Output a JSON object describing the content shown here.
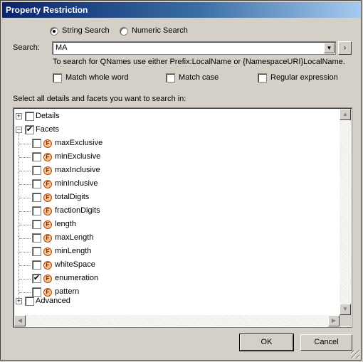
{
  "window": {
    "title": "Property Restriction"
  },
  "search_type": {
    "string_label": "String Search",
    "numeric_label": "Numeric Search",
    "selected": "string"
  },
  "search": {
    "label": "Search:",
    "value": "MA",
    "hint": "To search for QNames use either Prefix:LocalName or {NamespaceURI}LocalName."
  },
  "options": {
    "match_whole_word": {
      "label": "Match whole word",
      "checked": false
    },
    "match_case": {
      "label": "Match case",
      "checked": false
    },
    "regex": {
      "label": "Regular expression",
      "checked": false
    }
  },
  "tree_label": "Select all details and facets you want to search in:",
  "tree": {
    "details": {
      "label": "Details",
      "checked": false,
      "expanded": false
    },
    "facets": {
      "label": "Facets",
      "checked": true,
      "expanded": true,
      "icon_letter": "F",
      "items": [
        {
          "label": "maxExclusive",
          "checked": false
        },
        {
          "label": "minExclusive",
          "checked": false
        },
        {
          "label": "maxInclusive",
          "checked": false
        },
        {
          "label": "minInclusive",
          "checked": false
        },
        {
          "label": "totalDigits",
          "checked": false
        },
        {
          "label": "fractionDigits",
          "checked": false
        },
        {
          "label": "length",
          "checked": false
        },
        {
          "label": "maxLength",
          "checked": false
        },
        {
          "label": "minLength",
          "checked": false
        },
        {
          "label": "whiteSpace",
          "checked": false
        },
        {
          "label": "enumeration",
          "checked": true
        },
        {
          "label": "pattern",
          "checked": false
        }
      ]
    },
    "advanced": {
      "label": "Advanced",
      "checked": false,
      "expanded": false
    }
  },
  "buttons": {
    "ok": "OK",
    "cancel": "Cancel"
  },
  "glyphs": {
    "check": "✔",
    "plus": "+",
    "minus": "−",
    "combo_arrow": "▼",
    "go_arrow": "›",
    "up": "▲",
    "down": "▼",
    "left": "◀",
    "right": "▶"
  },
  "colors": {
    "title_start": "#0a246a",
    "title_end": "#a6caf0",
    "face": "#d4d0c8",
    "facet_icon": "#f3c08a"
  }
}
